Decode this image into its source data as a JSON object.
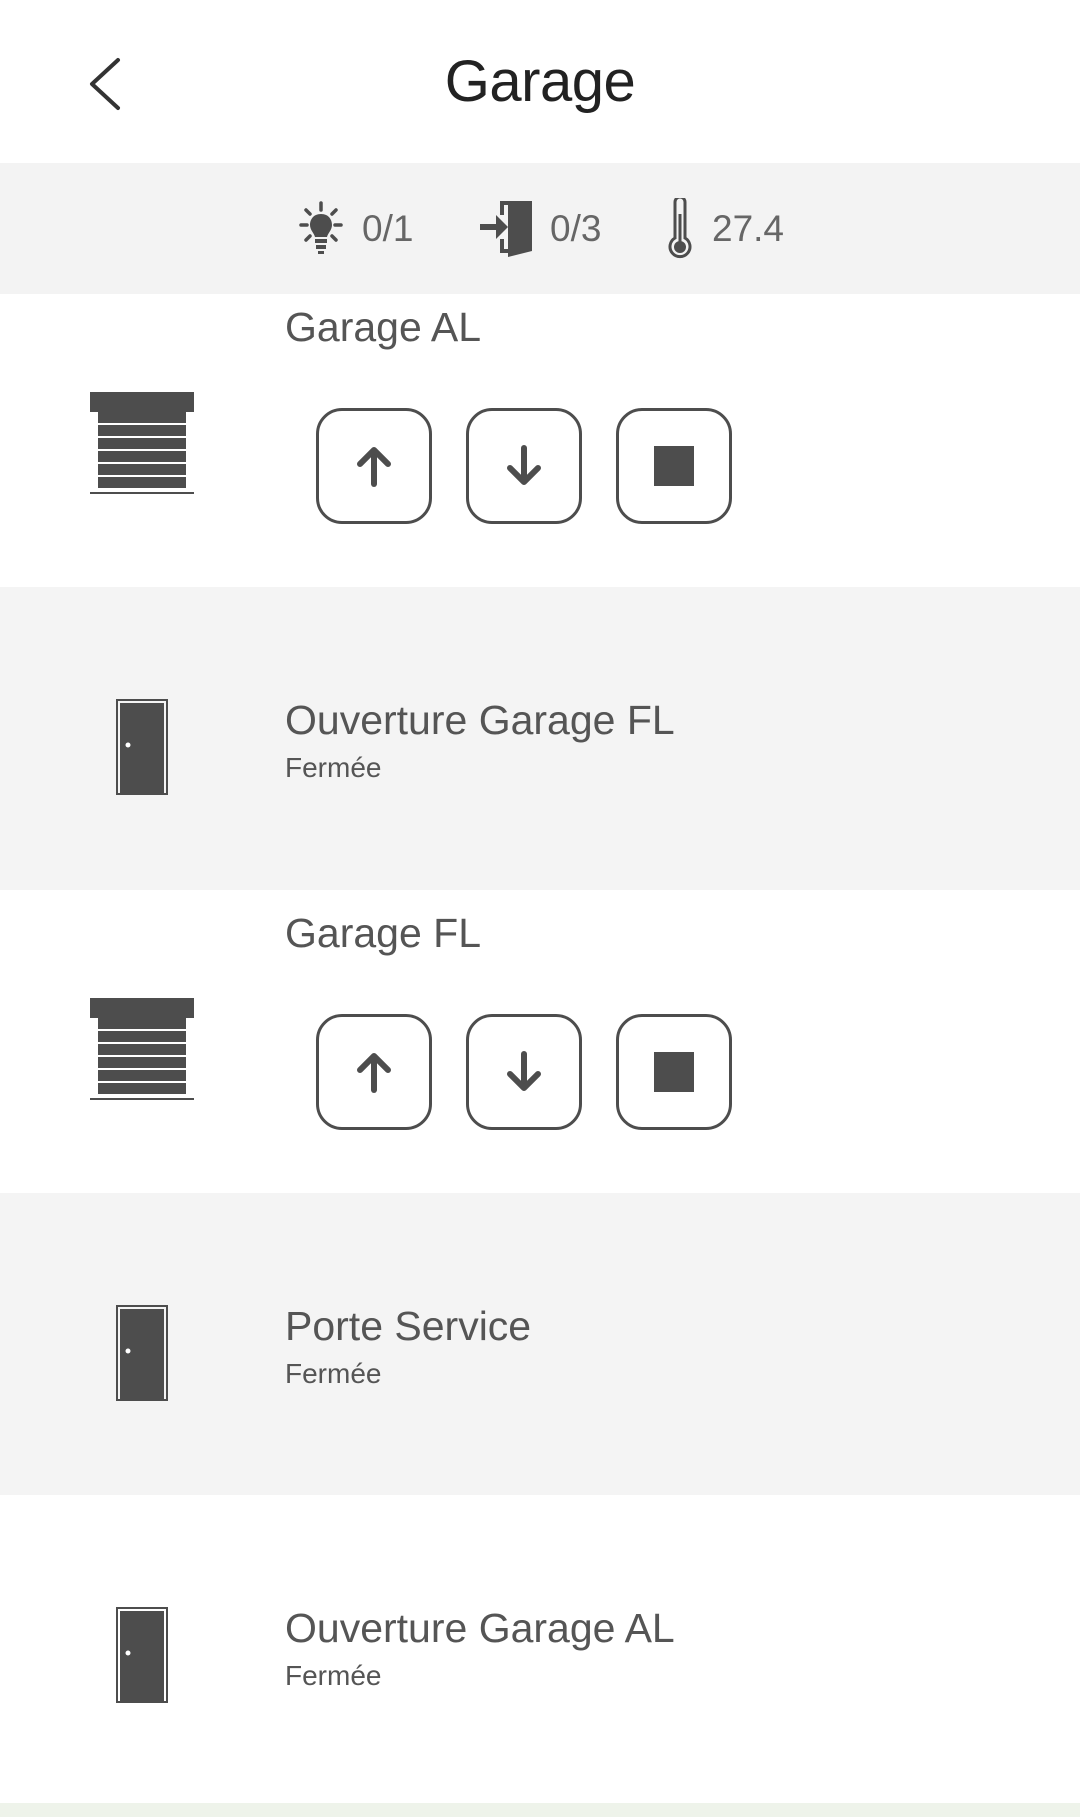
{
  "header": {
    "title": "Garage",
    "back_icon": "chevron-left-icon"
  },
  "status": {
    "lights": {
      "icon": "lightbulb-icon",
      "value": "0/1"
    },
    "openings": {
      "icon": "door-enter-icon",
      "value": "0/3"
    },
    "temperature": {
      "icon": "thermometer-icon",
      "value": "27.4"
    }
  },
  "devices": [
    {
      "type": "shutter",
      "name": "Garage AL",
      "icon": "garage-shutter-icon",
      "controls": {
        "up": "arrow-up-icon",
        "down": "arrow-down-icon",
        "stop": "stop-icon"
      }
    },
    {
      "type": "door",
      "name": "Ouverture Garage FL",
      "status": "Fermée",
      "icon": "door-icon"
    },
    {
      "type": "shutter",
      "name": "Garage FL",
      "icon": "garage-shutter-icon",
      "controls": {
        "up": "arrow-up-icon",
        "down": "arrow-down-icon",
        "stop": "stop-icon"
      }
    },
    {
      "type": "door",
      "name": "Porte Service",
      "status": "Fermée",
      "icon": "door-icon"
    },
    {
      "type": "door",
      "name": "Ouverture Garage AL",
      "status": "Fermée",
      "icon": "door-icon"
    }
  ],
  "colors": {
    "icon": "#4d4d4d",
    "row_alt_background": "#f4f4f4",
    "status_bar_background": "#f3f3f3"
  }
}
